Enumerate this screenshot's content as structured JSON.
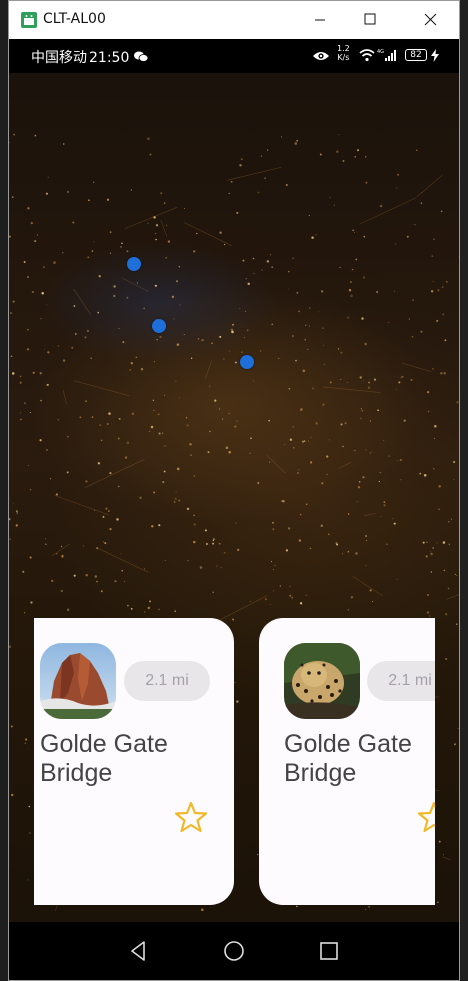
{
  "window": {
    "title": "CLT-AL00",
    "controls": {
      "minimize": "minimize",
      "maximize": "maximize",
      "close": "close"
    }
  },
  "status_bar": {
    "carrier": "中国移动",
    "time": "21:50",
    "speed_value": "1.2",
    "speed_unit": "K/s",
    "battery": "82",
    "icons": [
      "wechat-icon",
      "eye-icon",
      "wifi-icon",
      "signal-4g-icon",
      "battery-icon",
      "charging-icon"
    ]
  },
  "map": {
    "markers": [
      {
        "name": "marker-1"
      },
      {
        "name": "marker-2"
      },
      {
        "name": "marker-3"
      }
    ],
    "marker_color": "#1e6fd9"
  },
  "cards": [
    {
      "title": "Golde Gate Bridge",
      "distance": "2.1 mi",
      "image": "red-rock-mountain-photo",
      "favorite": false
    },
    {
      "title": "Golde Gate Bridge",
      "distance": "2.1 mi",
      "image": "leopard-photo",
      "favorite": false
    }
  ],
  "colors": {
    "card_bg": "#fdfbfd",
    "chip_bg": "#e9e6ea",
    "chip_text": "#a5a1a8",
    "star": "#f0b92c",
    "title_text": "#444444"
  },
  "nav_bar": {
    "icons": [
      "back-icon",
      "home-icon",
      "recent-apps-icon"
    ]
  }
}
